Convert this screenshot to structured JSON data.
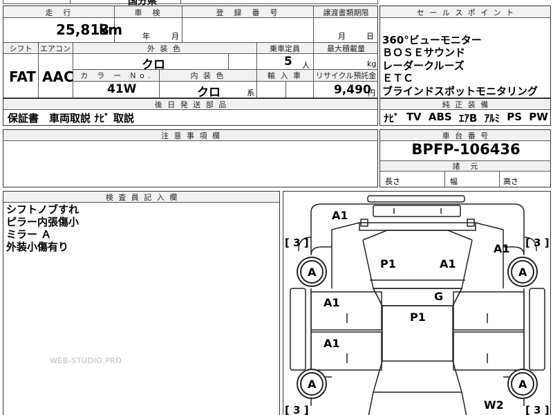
{
  "top_strip": {
    "partial_text": "国分県"
  },
  "mileage": {
    "header": "走　行",
    "value": "25,813",
    "unit": "km"
  },
  "inspection": {
    "header": "車　検",
    "year_unit": "年",
    "month_unit": "月"
  },
  "registration": {
    "header": "登　録　番　号",
    "value": ""
  },
  "transfer": {
    "header": "譲渡書類期限",
    "month_unit": "月",
    "day_unit": "日"
  },
  "shift": {
    "header": "シフト",
    "value": "FAT"
  },
  "aircon": {
    "header": "エアコン",
    "value": "AAC"
  },
  "exterior_color": {
    "header": "外 装 色",
    "value": "クロ"
  },
  "capacity": {
    "header": "乗車定員",
    "value": "5",
    "unit": "人"
  },
  "max_load": {
    "header": "最大積載量",
    "unit": "kg"
  },
  "color_no": {
    "header": "カ　ラ　ー　N o .",
    "value": "41W"
  },
  "interior_color": {
    "header": "内 装 色",
    "value": "クロ",
    "suffix": "系"
  },
  "import_car": {
    "header": "輸 入 車"
  },
  "recycle": {
    "header": "リサイクル預託金",
    "value": "9,490",
    "unit": "円"
  },
  "shipping": {
    "header": "後 日 発 送 部 品",
    "value": "保証書　車両取説 ﾅﾋﾞ 取説"
  },
  "notes": {
    "header": "注 意 事 項 欄"
  },
  "sales_points": {
    "header": "セ ー ル ス ポ イ ン ト",
    "items": [
      "360°ビューモニター",
      "ＢＯＳＥサウンド",
      "レーダークルーズ",
      "ＥＴＣ",
      "ブラインドスポットモニタリング"
    ]
  },
  "equipment": {
    "header": "純 正 装 備",
    "items": [
      "ﾅﾋﾞ",
      "TV",
      "ABS",
      "ｴｱB",
      "ｱﾙﾐ",
      "PS",
      "PW"
    ]
  },
  "chassis": {
    "header": "車 台 番 号",
    "value": "BPFP-106436"
  },
  "dimensions": {
    "header": "諸　元",
    "length": "長さ",
    "width": "幅",
    "height": "高さ"
  },
  "inspector": {
    "header": "検 査 員 記 入 欄",
    "comments": [
      "シフトノブすれ",
      "ピラー内張傷小",
      "ミラー Ａ",
      "外装小傷有り"
    ]
  },
  "damage_map": {
    "tire_label": "A",
    "tread_label": "[ 3 ]",
    "marks": {
      "bumper_front": "A1",
      "front_right": "A1",
      "hood_left": "P1",
      "hood_right": "A1",
      "door_front_left": "A1",
      "door_rear_left": "A1",
      "roof": "P1",
      "windshield": "G",
      "rear_right": "W2"
    }
  },
  "watermark": "WEB-STUDIO.PRO"
}
